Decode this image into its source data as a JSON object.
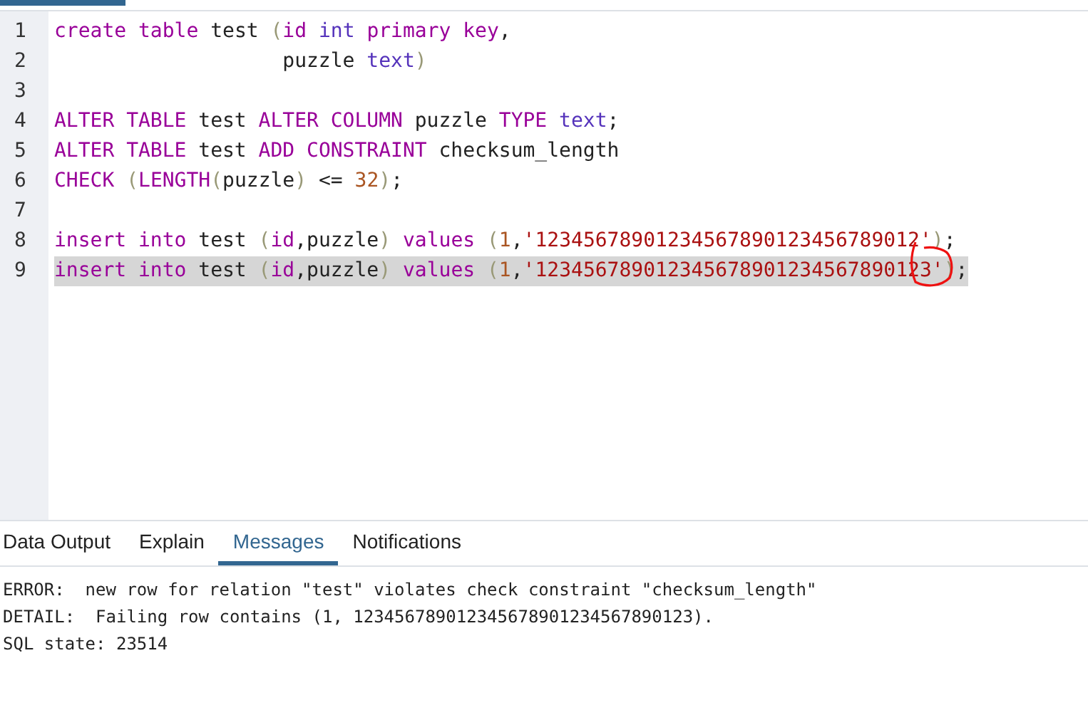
{
  "editor": {
    "lines": [
      {
        "number": "1",
        "selected": false,
        "tokens": [
          {
            "kind": "keyword",
            "text": "create table"
          },
          {
            "kind": "plain",
            "text": " test "
          },
          {
            "kind": "paren",
            "text": "("
          },
          {
            "kind": "keyword",
            "text": "id "
          },
          {
            "kind": "type",
            "text": "int "
          },
          {
            "kind": "keyword",
            "text": "primary key"
          },
          {
            "kind": "plain",
            "text": ","
          }
        ]
      },
      {
        "number": "2",
        "selected": false,
        "tokens": [
          {
            "kind": "plain",
            "text": "                   puzzle "
          },
          {
            "kind": "type",
            "text": "text"
          },
          {
            "kind": "paren",
            "text": ")"
          }
        ]
      },
      {
        "number": "3",
        "selected": false
      },
      {
        "number": "4",
        "selected": false,
        "tokens": [
          {
            "kind": "keyword",
            "text": "ALTER TABLE"
          },
          {
            "kind": "plain",
            "text": " test "
          },
          {
            "kind": "keyword",
            "text": "ALTER COLUMN"
          },
          {
            "kind": "plain",
            "text": " puzzle "
          },
          {
            "kind": "keyword",
            "text": "TYPE "
          },
          {
            "kind": "type",
            "text": "text"
          },
          {
            "kind": "plain",
            "text": ";"
          }
        ]
      },
      {
        "number": "5",
        "selected": false,
        "tokens": [
          {
            "kind": "keyword",
            "text": "ALTER TABLE"
          },
          {
            "kind": "plain",
            "text": " test "
          },
          {
            "kind": "keyword",
            "text": "ADD CONSTRAINT"
          },
          {
            "kind": "plain",
            "text": " checksum_length"
          }
        ]
      },
      {
        "number": "6",
        "selected": false,
        "tokens": [
          {
            "kind": "keyword",
            "text": "CHECK "
          },
          {
            "kind": "paren",
            "text": "("
          },
          {
            "kind": "keyword",
            "text": "LENGTH"
          },
          {
            "kind": "paren",
            "text": "("
          },
          {
            "kind": "plain",
            "text": "puzzle"
          },
          {
            "kind": "paren",
            "text": ")"
          },
          {
            "kind": "plain",
            "text": " <= "
          },
          {
            "kind": "number",
            "text": "32"
          },
          {
            "kind": "paren",
            "text": ")"
          },
          {
            "kind": "plain",
            "text": ";"
          }
        ]
      },
      {
        "number": "7",
        "selected": false
      },
      {
        "number": "8",
        "selected": false,
        "tokens": [
          {
            "kind": "keyword",
            "text": "insert into"
          },
          {
            "kind": "plain",
            "text": " test "
          },
          {
            "kind": "paren",
            "text": "("
          },
          {
            "kind": "keyword",
            "text": "id"
          },
          {
            "kind": "plain",
            "text": ",puzzle"
          },
          {
            "kind": "paren",
            "text": ")"
          },
          {
            "kind": "keyword",
            "text": " values "
          },
          {
            "kind": "paren",
            "text": "("
          },
          {
            "kind": "number",
            "text": "1"
          },
          {
            "kind": "plain",
            "text": ","
          },
          {
            "kind": "string",
            "text": "'12345678901234567890123456789012'"
          },
          {
            "kind": "paren",
            "text": ")"
          },
          {
            "kind": "plain",
            "text": ";"
          }
        ]
      },
      {
        "number": "9",
        "selected": true,
        "circled": true,
        "tokens": [
          {
            "kind": "keyword",
            "text": "insert into"
          },
          {
            "kind": "plain",
            "text": " test "
          },
          {
            "kind": "paren",
            "text": "("
          },
          {
            "kind": "keyword",
            "text": "id"
          },
          {
            "kind": "plain",
            "text": ",puzzle"
          },
          {
            "kind": "paren",
            "text": ")"
          },
          {
            "kind": "keyword",
            "text": " values "
          },
          {
            "kind": "paren",
            "text": "("
          },
          {
            "kind": "number",
            "text": "1"
          },
          {
            "kind": "plain",
            "text": ","
          },
          {
            "kind": "string",
            "text": "'123456789012345678901234567890123'"
          },
          {
            "kind": "paren",
            "text": ")"
          },
          {
            "kind": "plain",
            "text": ";"
          }
        ]
      }
    ]
  },
  "tabs": [
    {
      "label": "Data Output",
      "selected": false
    },
    {
      "label": "Explain",
      "selected": false
    },
    {
      "label": "Messages",
      "selected": true
    },
    {
      "label": "Notifications",
      "selected": false
    }
  ],
  "messages": [
    "ERROR:  new row for relation \"test\" violates check constraint \"checksum_length\"",
    "DETAIL:  Failing row contains (1, 123456789012345678901234567890123).",
    "SQL state: 23514"
  ]
}
